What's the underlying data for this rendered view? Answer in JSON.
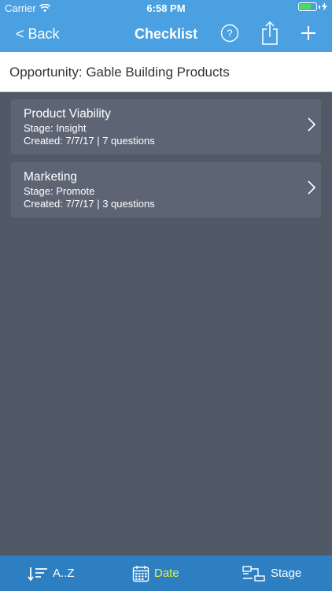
{
  "status_bar": {
    "carrier": "Carrier",
    "time": "6:58 PM",
    "battery_level": 0.7
  },
  "nav": {
    "back_label": "< Back",
    "title": "Checklist",
    "help_icon": "question-circle-icon",
    "share_icon": "share-icon",
    "add_icon": "plus-icon"
  },
  "subheader": {
    "text": "Opportunity: Gable Building Products"
  },
  "cards": [
    {
      "title": "Product Viability",
      "stage": "Stage: Insight",
      "meta": "Created: 7/7/17 | 7 questions"
    },
    {
      "title": "Marketing",
      "stage": "Stage: Promote",
      "meta": "Created: 7/7/17 | 3 questions"
    }
  ],
  "tabs": [
    {
      "label": "A..Z",
      "icon": "sort-icon"
    },
    {
      "label": "Date",
      "icon": "calendar-icon"
    },
    {
      "label": "Stage",
      "icon": "stage-icon"
    }
  ],
  "colors": {
    "header": "#4aa0e1",
    "tab_bar": "#2e7fc2",
    "active_tab": "#e6f23a",
    "background": "#505965",
    "card": "#5d6575"
  }
}
